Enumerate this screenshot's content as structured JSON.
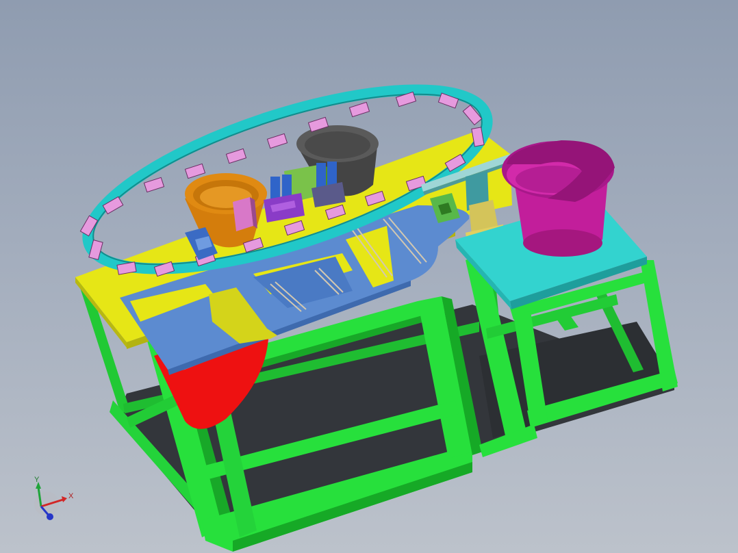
{
  "viewport": {
    "background_top": "#8f9cb0",
    "background_bottom": "#bcc2cb"
  },
  "colors": {
    "frame": "#27e03c",
    "frame_dark": "#16a926",
    "top_plate_yellow": "#e6e616",
    "plate_blue": "#5c8bd0",
    "track_cyan": "#21c8c8",
    "carrier_pink": "#e69ade",
    "bowl_orange": "#e08a12",
    "bowl_gray": "#5a5a5a",
    "bowl_magenta": "#c21e9b",
    "bin_red": "#ee1111",
    "side_table": "#33d3cf"
  },
  "triad": {
    "x_label": "X",
    "y_label": "Y",
    "x_icon": "x-axis-arrow-icon",
    "y_icon": "y-axis-arrow-icon",
    "z_icon": "z-axis-arrow-icon"
  }
}
